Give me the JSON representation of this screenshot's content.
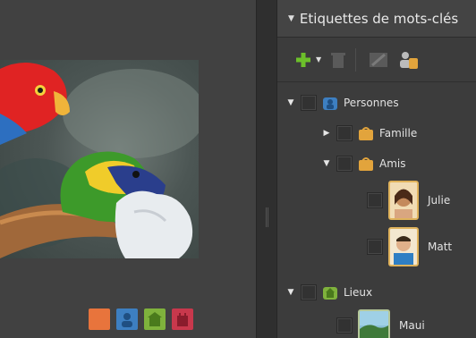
{
  "panel": {
    "title": "Etiquettes de mots-clés",
    "toolbar": {
      "icons": [
        "add-icon",
        "dropdown-icon",
        "trash-icon",
        "edit-icon",
        "people-tag-icon"
      ]
    }
  },
  "tree": [
    {
      "label": "Personnes",
      "expanded": true,
      "icon": "person-tag-icon",
      "color": "#3d7fc1"
    },
    {
      "label": "Famille",
      "expanded": false,
      "icon": "tag-icon",
      "color": "#e2a43c"
    },
    {
      "label": "Amis",
      "expanded": true,
      "icon": "tag-icon",
      "color": "#e2a43c"
    },
    {
      "label": "Julie",
      "icon": "photo-tag-icon"
    },
    {
      "label": "Matt",
      "icon": "photo-tag-icon"
    },
    {
      "label": "Lieux",
      "expanded": true,
      "icon": "place-tag-icon",
      "color": "#7fb23c"
    },
    {
      "label": "Maui",
      "icon": "photo-tag-icon"
    }
  ],
  "tag_strip": [
    {
      "icon": "orange-tag-icon",
      "color": "#e8743c"
    },
    {
      "icon": "blue-person-tag-icon",
      "color": "#3d7fc1"
    },
    {
      "icon": "green-place-tag-icon",
      "color": "#7fb23c"
    },
    {
      "icon": "red-event-tag-icon",
      "color": "#c8384c"
    }
  ]
}
